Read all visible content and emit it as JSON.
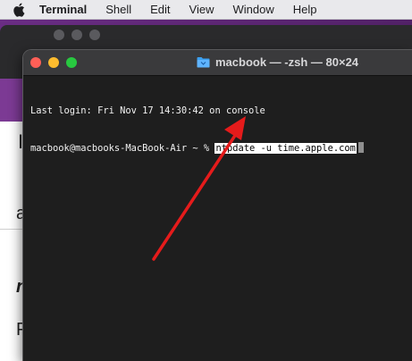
{
  "menubar": {
    "items": [
      "Terminal",
      "Shell",
      "Edit",
      "View",
      "Window",
      "Help"
    ]
  },
  "terminal": {
    "title": "macbook — -zsh — 80×24",
    "last_login": "Last login: Fri Nov 17 14:30:42 on console",
    "prompt": "macbook@macbooks-MacBook-Air ~ % ",
    "command": "ntpdate -u time.apple.com"
  },
  "background_doc": {
    "glyphs": [
      "If",
      "a",
      "n",
      "P"
    ]
  },
  "colors": {
    "close": "#ff5f57",
    "minimize": "#febc2e",
    "zoom": "#28c840",
    "annotation_arrow": "#e51b1b",
    "wallpaper": "#5b2a6e"
  },
  "icons": [
    "apple-icon",
    "folder-icon",
    "annotation-arrow"
  ]
}
